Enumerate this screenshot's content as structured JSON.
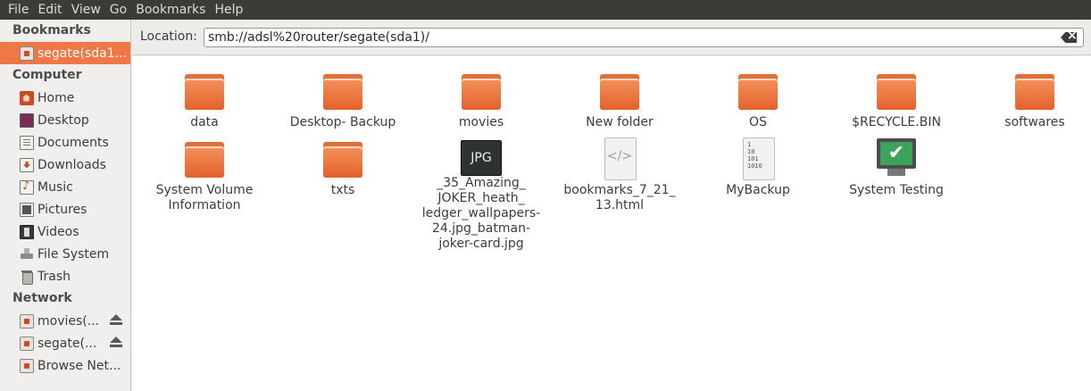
{
  "menubar": {
    "items": [
      "File",
      "Edit",
      "View",
      "Go",
      "Bookmarks",
      "Help"
    ]
  },
  "sidebar": {
    "bookmarks_header": "Bookmarks",
    "bookmarks": [
      {
        "label": "segate(sda1...",
        "icon": "network-drive-icon",
        "selected": true
      }
    ],
    "computer_header": "Computer",
    "computer": [
      {
        "label": "Home",
        "icon": "home-icon"
      },
      {
        "label": "Desktop",
        "icon": "desktop-icon"
      },
      {
        "label": "Documents",
        "icon": "documents-icon"
      },
      {
        "label": "Downloads",
        "icon": "downloads-icon"
      },
      {
        "label": "Music",
        "icon": "music-icon"
      },
      {
        "label": "Pictures",
        "icon": "pictures-icon"
      },
      {
        "label": "Videos",
        "icon": "videos-icon"
      },
      {
        "label": "File System",
        "icon": "file-system-icon"
      },
      {
        "label": "Trash",
        "icon": "trash-icon"
      }
    ],
    "network_header": "Network",
    "network": [
      {
        "label": "movies(...",
        "icon": "network-drive-icon",
        "eject": true
      },
      {
        "label": "segate(...",
        "icon": "network-drive-icon",
        "eject": true
      },
      {
        "label": "Browse Net...",
        "icon": "network-drive-icon",
        "eject": false
      }
    ],
    "selection_color": "#f07746"
  },
  "location": {
    "label": "Location:",
    "value": "smb://adsl%20router/segate(sda1)/"
  },
  "files": [
    {
      "name": "data",
      "type": "folder"
    },
    {
      "name": "Desktop- Backup",
      "type": "folder"
    },
    {
      "name": "movies",
      "type": "folder"
    },
    {
      "name": "New folder",
      "type": "folder"
    },
    {
      "name": "OS",
      "type": "folder"
    },
    {
      "name": "$RECYCLE.BIN",
      "type": "folder"
    },
    {
      "name": "softwares",
      "type": "folder"
    },
    {
      "name": "System Volume Information",
      "type": "folder"
    },
    {
      "name": "txts",
      "type": "folder"
    },
    {
      "name": "_35_Amazing_ JOKER_heath_ ledger_wallpapers- 24.jpg_batman- joker-card.jpg",
      "type": "jpg",
      "icon_text": "JPG"
    },
    {
      "name": "bookmarks_7_21_ 13.html",
      "type": "html",
      "icon_text": "</>"
    },
    {
      "name": "MyBackup",
      "type": "binary",
      "icon_text": "1\n10\n101\n1010"
    },
    {
      "name": "System Testing",
      "type": "executable",
      "icon_text": "✔"
    }
  ],
  "colors": {
    "menubar_bg": "#3c3b37",
    "folder_orange": "#e46e38",
    "accent": "#f07746"
  }
}
